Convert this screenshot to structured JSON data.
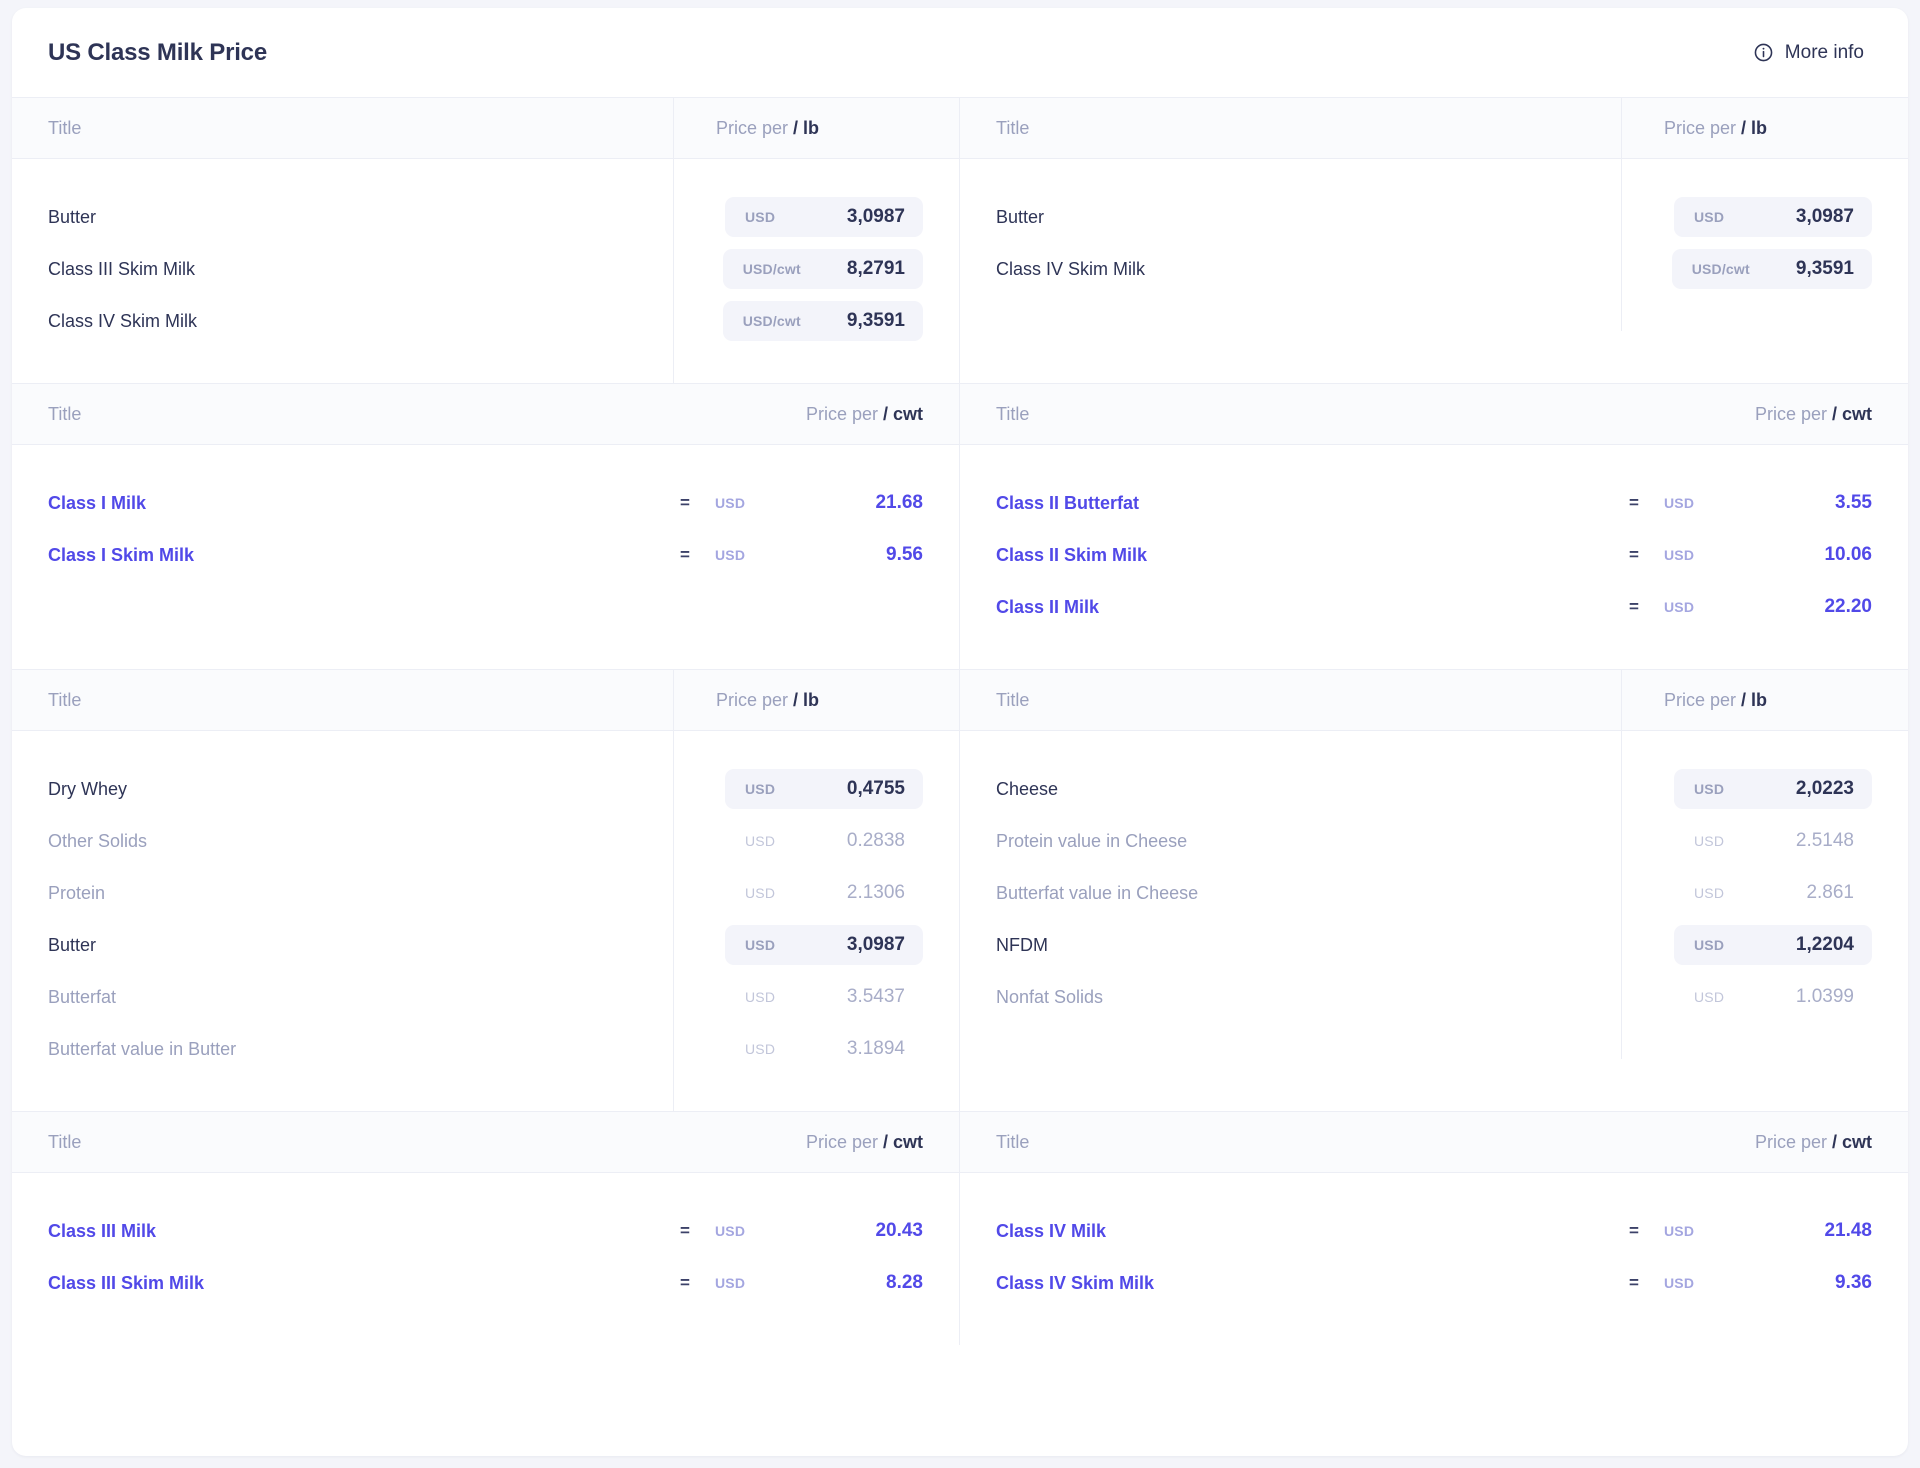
{
  "header": {
    "title": "US Class Milk Price",
    "more_info_label": "More info",
    "info_icon": "info-circle-icon"
  },
  "colors": {
    "accent": "#5149e8",
    "text_dark": "#2e3456",
    "text_muted": "#9aa0bd",
    "pill_bg": "#f3f4fa",
    "header_bg": "#fafbfd",
    "border": "#eceef5",
    "page_bg": "#f4f5fa"
  },
  "sections": [
    {
      "id": "section-1",
      "style": "lb",
      "left": {
        "headers": {
          "title": "Title",
          "price_prefix": "Price per",
          "price_unit": "/ lb"
        },
        "rows": [
          {
            "name": "Butter",
            "currency": "USD",
            "value": "3,0987",
            "highlight": true
          },
          {
            "name": "Class III Skim Milk",
            "currency": "USD/cwt",
            "value": "8,2791",
            "highlight": true
          },
          {
            "name": "Class IV Skim Milk",
            "currency": "USD/cwt",
            "value": "9,3591",
            "highlight": true
          }
        ]
      },
      "right": {
        "headers": {
          "title": "Title",
          "price_prefix": "Price per",
          "price_unit": "/ lb"
        },
        "rows": [
          {
            "name": "Butter",
            "currency": "USD",
            "value": "3,0987",
            "highlight": true
          },
          {
            "name": "Class IV Skim Milk",
            "currency": "USD/cwt",
            "value": "9,3591",
            "highlight": true
          }
        ]
      }
    },
    {
      "id": "section-2",
      "style": "cwt",
      "left": {
        "headers": {
          "title": "Title",
          "price_prefix": "Price per",
          "price_unit": "/ cwt"
        },
        "rows": [
          {
            "name": "Class I Milk",
            "eq": "=",
            "currency": "USD",
            "value": "21.68"
          },
          {
            "name": "Class I Skim Milk",
            "eq": "=",
            "currency": "USD",
            "value": "9.56"
          }
        ]
      },
      "right": {
        "headers": {
          "title": "Title",
          "price_prefix": "Price per",
          "price_unit": "/ cwt"
        },
        "rows": [
          {
            "name": "Class II Butterfat",
            "eq": "=",
            "currency": "USD",
            "value": "3.55"
          },
          {
            "name": "Class II Skim Milk",
            "eq": "=",
            "currency": "USD",
            "value": "10.06"
          },
          {
            "name": "Class II Milk",
            "eq": "=",
            "currency": "USD",
            "value": "22.20"
          }
        ]
      }
    },
    {
      "id": "section-3",
      "style": "lb",
      "left": {
        "headers": {
          "title": "Title",
          "price_prefix": "Price per",
          "price_unit": "/ lb"
        },
        "rows": [
          {
            "name": "Dry Whey",
            "currency": "USD",
            "value": "0,4755",
            "highlight": true
          },
          {
            "name": "Other Solids",
            "currency": "USD",
            "value": "0.2838",
            "highlight": false
          },
          {
            "name": "Protein",
            "currency": "USD",
            "value": "2.1306",
            "highlight": false
          },
          {
            "name": "Butter",
            "currency": "USD",
            "value": "3,0987",
            "highlight": true
          },
          {
            "name": "Butterfat",
            "currency": "USD",
            "value": "3.5437",
            "highlight": false
          },
          {
            "name": "Butterfat value in Butter",
            "currency": "USD",
            "value": "3.1894",
            "highlight": false
          }
        ]
      },
      "right": {
        "headers": {
          "title": "Title",
          "price_prefix": "Price per",
          "price_unit": "/ lb"
        },
        "rows": [
          {
            "name": "Cheese",
            "currency": "USD",
            "value": "2,0223",
            "highlight": true
          },
          {
            "name": "Protein value in Cheese",
            "currency": "USD",
            "value": "2.5148",
            "highlight": false
          },
          {
            "name": "Butterfat value in Cheese",
            "currency": "USD",
            "value": "2.861",
            "highlight": false
          },
          {
            "name": "NFDM",
            "currency": "USD",
            "value": "1,2204",
            "highlight": true
          },
          {
            "name": "Nonfat Solids",
            "currency": "USD",
            "value": "1.0399",
            "highlight": false
          }
        ]
      }
    },
    {
      "id": "section-4",
      "style": "cwt",
      "left": {
        "headers": {
          "title": "Title",
          "price_prefix": "Price per",
          "price_unit": "/ cwt"
        },
        "rows": [
          {
            "name": "Class III Milk",
            "eq": "=",
            "currency": "USD",
            "value": "20.43"
          },
          {
            "name": "Class III Skim Milk",
            "eq": "=",
            "currency": "USD",
            "value": "8.28"
          }
        ]
      },
      "right": {
        "headers": {
          "title": "Title",
          "price_prefix": "Price per",
          "price_unit": "/ cwt"
        },
        "rows": [
          {
            "name": "Class IV Milk",
            "eq": "=",
            "currency": "USD",
            "value": "21.48"
          },
          {
            "name": "Class IV Skim Milk",
            "eq": "=",
            "currency": "USD",
            "value": "9.36"
          }
        ]
      }
    }
  ]
}
